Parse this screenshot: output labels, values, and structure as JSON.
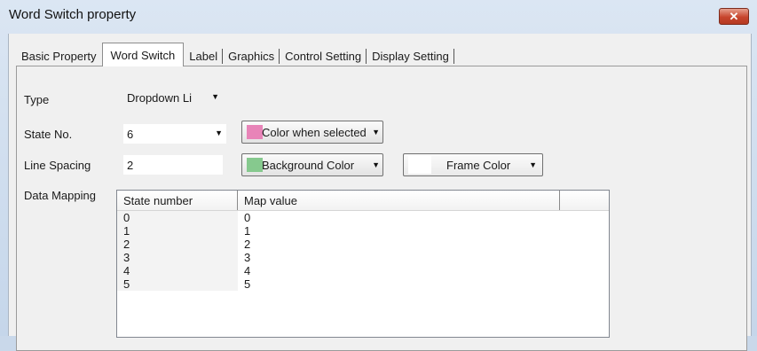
{
  "window": {
    "title": "Word Switch property",
    "close_glyph": "✕"
  },
  "tabs": [
    {
      "label": "Basic Property",
      "active": false
    },
    {
      "label": "Word Switch",
      "active": true
    },
    {
      "label": "Label",
      "active": false
    },
    {
      "label": "Graphics",
      "active": false
    },
    {
      "label": "Control Setting",
      "active": false
    },
    {
      "label": "Display Setting",
      "active": false
    }
  ],
  "form": {
    "type_label": "Type",
    "type_value": "Dropdown Li",
    "state_no_label": "State No.",
    "state_no_value": "6",
    "line_spacing_label": "Line Spacing",
    "line_spacing_value": "2",
    "data_mapping_label": "Data Mapping"
  },
  "buttons": {
    "color_selected_label": "Color when selected",
    "color_selected_swatch": "#e884b8",
    "background_color_label": "Background Color",
    "background_color_swatch": "#86c98e",
    "frame_color_label": "Frame Color",
    "frame_color_swatch": "#ffffff"
  },
  "table": {
    "columns": [
      "State number",
      "Map value"
    ],
    "rows": [
      [
        "0",
        "0"
      ],
      [
        "1",
        "1"
      ],
      [
        "2",
        "2"
      ],
      [
        "3",
        "3"
      ],
      [
        "4",
        "4"
      ],
      [
        "5",
        "5"
      ]
    ]
  },
  "icons": {
    "dropdown": "▼",
    "close": "close-icon"
  }
}
